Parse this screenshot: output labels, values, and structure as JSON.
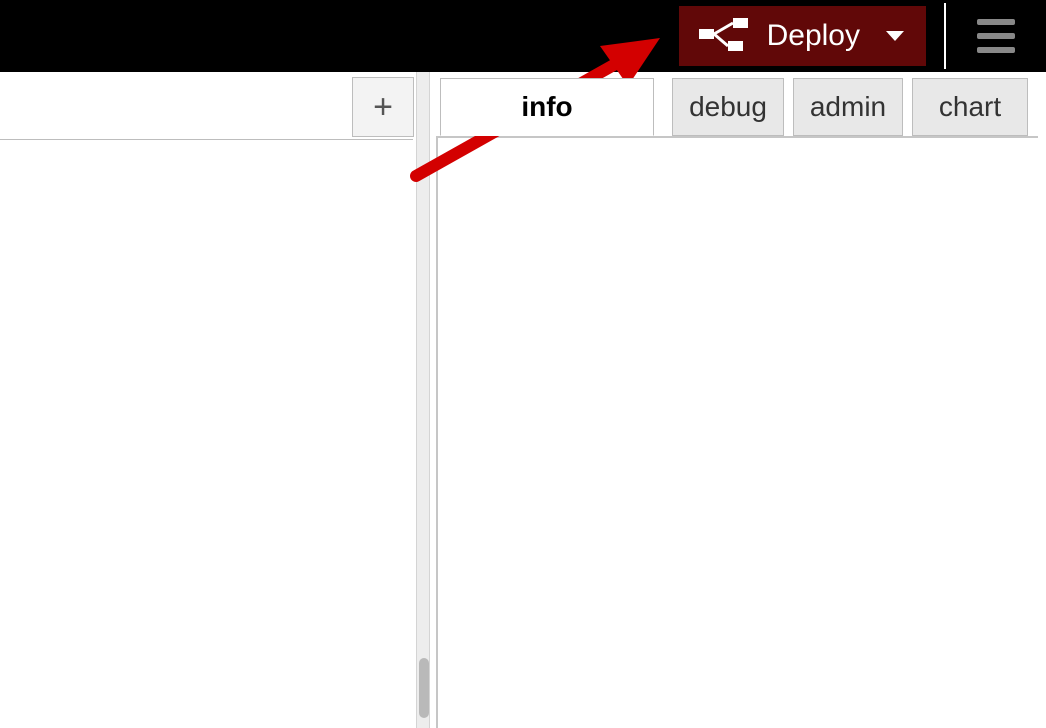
{
  "header": {
    "deploy_label": "Deploy"
  },
  "left": {
    "add_tab_symbol": "+"
  },
  "tabs": {
    "info": "info",
    "debug": "debug",
    "admin": "admin",
    "chart": "chart"
  }
}
